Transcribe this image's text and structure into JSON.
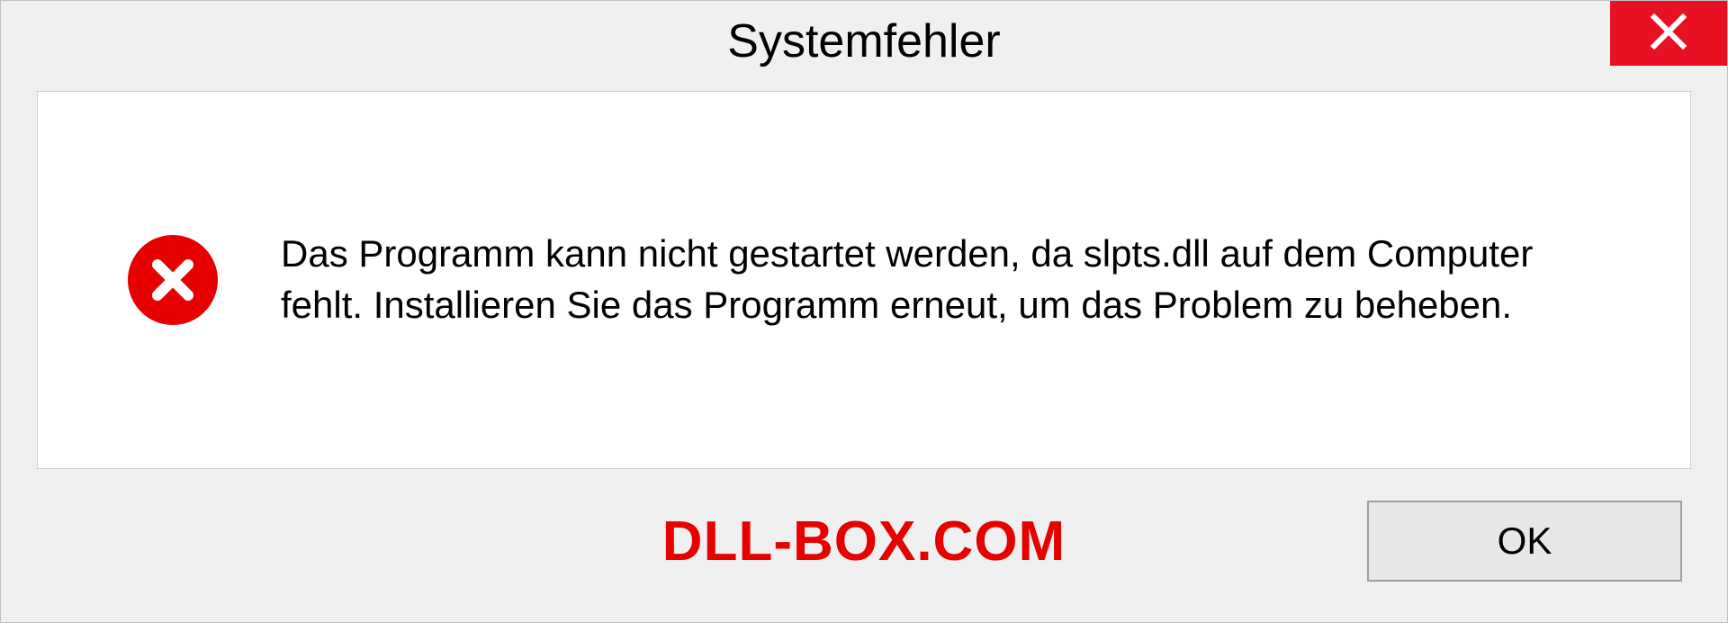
{
  "dialog": {
    "title": "Systemfehler",
    "message": "Das Programm kann nicht gestartet werden, da slpts.dll auf dem Computer fehlt. Installieren Sie das Programm erneut, um das Problem zu beheben.",
    "ok_label": "OK"
  },
  "watermark": "DLL-BOX.COM"
}
